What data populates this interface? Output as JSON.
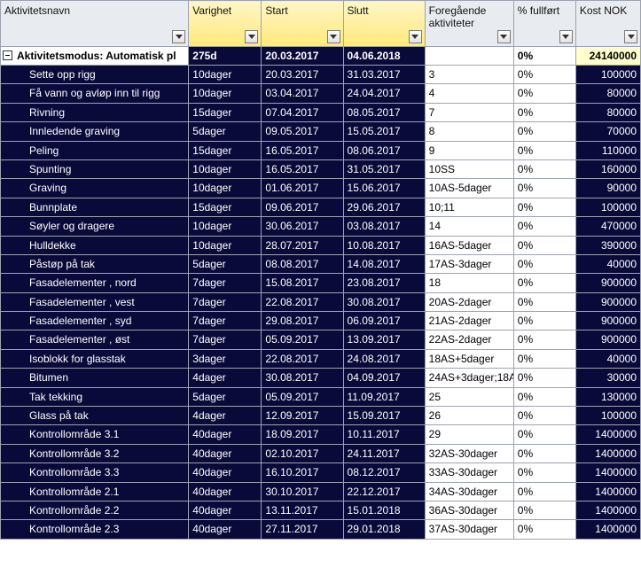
{
  "columns": {
    "name": "Aktivitetsnavn",
    "duration": "Varighet",
    "start": "Start",
    "end": "Slutt",
    "predecessors": "Foregående aktiviteter",
    "pct": "% fullført",
    "cost": "Kost NOK"
  },
  "summary": {
    "name": "Aktivitetsmodus: Automatisk pl",
    "duration": "275d",
    "start": "20.03.2017",
    "end": "04.06.2018",
    "predecessors": "",
    "pct": "0%",
    "cost": "24140000"
  },
  "rows": [
    {
      "name": "Sette opp rigg",
      "duration": "10dager",
      "start": "20.03.2017",
      "end": "31.03.2017",
      "predecessors": "3",
      "pct": "0%",
      "cost": "100000"
    },
    {
      "name": "Få vann og avløp inn til rigg",
      "duration": "10dager",
      "start": "03.04.2017",
      "end": "24.04.2017",
      "predecessors": "4",
      "pct": "0%",
      "cost": "80000"
    },
    {
      "name": "Rivning",
      "duration": "15dager",
      "start": "07.04.2017",
      "end": "08.05.2017",
      "predecessors": "7",
      "pct": "0%",
      "cost": "80000"
    },
    {
      "name": "Innledende graving",
      "duration": "5dager",
      "start": "09.05.2017",
      "end": "15.05.2017",
      "predecessors": "8",
      "pct": "0%",
      "cost": "70000"
    },
    {
      "name": "Peling",
      "duration": "15dager",
      "start": "16.05.2017",
      "end": "08.06.2017",
      "predecessors": "9",
      "pct": "0%",
      "cost": "110000"
    },
    {
      "name": "Spunting",
      "duration": "10dager",
      "start": "16.05.2017",
      "end": "31.05.2017",
      "predecessors": "10SS",
      "pct": "0%",
      "cost": "160000"
    },
    {
      "name": "Graving",
      "duration": "10dager",
      "start": "01.06.2017",
      "end": "15.06.2017",
      "predecessors": "10AS-5dager",
      "pct": "0%",
      "cost": "90000"
    },
    {
      "name": "Bunnplate",
      "duration": "15dager",
      "start": "09.06.2017",
      "end": "29.06.2017",
      "predecessors": "10;11",
      "pct": "0%",
      "cost": "100000"
    },
    {
      "name": "Søyler og dragere",
      "duration": "10dager",
      "start": "30.06.2017",
      "end": "03.08.2017",
      "predecessors": "14",
      "pct": "0%",
      "cost": "470000"
    },
    {
      "name": "Hulldekke",
      "duration": "10dager",
      "start": "28.07.2017",
      "end": "10.08.2017",
      "predecessors": "16AS-5dager",
      "pct": "0%",
      "cost": "390000"
    },
    {
      "name": "Påstøp på tak",
      "duration": "5dager",
      "start": "08.08.2017",
      "end": "14.08.2017",
      "predecessors": "17AS-3dager",
      "pct": "0%",
      "cost": "40000"
    },
    {
      "name": "Fasadelementer , nord",
      "duration": "7dager",
      "start": "15.08.2017",
      "end": "23.08.2017",
      "predecessors": "18",
      "pct": "0%",
      "cost": "900000"
    },
    {
      "name": "Fasadelementer , vest",
      "duration": "7dager",
      "start": "22.08.2017",
      "end": "30.08.2017",
      "predecessors": "20AS-2dager",
      "pct": "0%",
      "cost": "900000"
    },
    {
      "name": "Fasadelementer , syd",
      "duration": "7dager",
      "start": "29.08.2017",
      "end": "06.09.2017",
      "predecessors": "21AS-2dager",
      "pct": "0%",
      "cost": "900000"
    },
    {
      "name": "Fasadelementer , øst",
      "duration": "7dager",
      "start": "05.09.2017",
      "end": "13.09.2017",
      "predecessors": "22AS-2dager",
      "pct": "0%",
      "cost": "900000"
    },
    {
      "name": "Isoblokk for glasstak",
      "duration": "3dager",
      "start": "22.08.2017",
      "end": "24.08.2017",
      "predecessors": "18AS+5dager",
      "pct": "0%",
      "cost": "40000"
    },
    {
      "name": "Bitumen",
      "duration": "4dager",
      "start": "30.08.2017",
      "end": "04.09.2017",
      "predecessors": "24AS+3dager;18A",
      "pct": "0%",
      "cost": "30000"
    },
    {
      "name": "Tak tekking",
      "duration": "5dager",
      "start": "05.09.2017",
      "end": "11.09.2017",
      "predecessors": "25",
      "pct": "0%",
      "cost": "130000"
    },
    {
      "name": "Glass på tak",
      "duration": "4dager",
      "start": "12.09.2017",
      "end": "15.09.2017",
      "predecessors": "26",
      "pct": "0%",
      "cost": "100000"
    },
    {
      "name": "Kontrollområde 3.1",
      "duration": "40dager",
      "start": "18.09.2017",
      "end": "10.11.2017",
      "predecessors": "29",
      "pct": "0%",
      "cost": "1400000"
    },
    {
      "name": "Kontrollområde 3.2",
      "duration": "40dager",
      "start": "02.10.2017",
      "end": "24.11.2017",
      "predecessors": "32AS-30dager",
      "pct": "0%",
      "cost": "1400000"
    },
    {
      "name": "Kontrollområde 3.3",
      "duration": "40dager",
      "start": "16.10.2017",
      "end": "08.12.2017",
      "predecessors": "33AS-30dager",
      "pct": "0%",
      "cost": "1400000"
    },
    {
      "name": "Kontrollområde 2.1",
      "duration": "40dager",
      "start": "30.10.2017",
      "end": "22.12.2017",
      "predecessors": "34AS-30dager",
      "pct": "0%",
      "cost": "1400000"
    },
    {
      "name": "Kontrollområde 2.2",
      "duration": "40dager",
      "start": "13.11.2017",
      "end": "15.01.2018",
      "predecessors": "36AS-30dager",
      "pct": "0%",
      "cost": "1400000"
    },
    {
      "name": "Kontrollområde 2.3",
      "duration": "40dager",
      "start": "27.11.2017",
      "end": "29.01.2018",
      "predecessors": "37AS-30dager",
      "pct": "0%",
      "cost": "1400000"
    }
  ]
}
